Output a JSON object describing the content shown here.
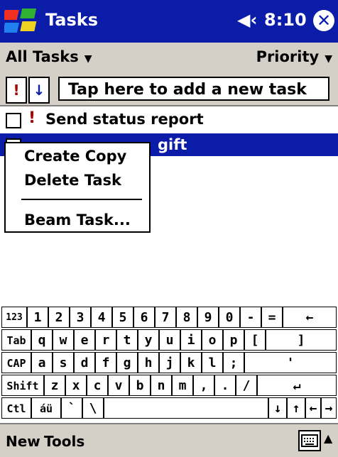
{
  "titlebar": {
    "app_title": "Tasks",
    "clock": "8:10",
    "speaker_icon": "speaker-icon",
    "close_icon": "close-icon",
    "start_icon": "windows-flag-icon"
  },
  "filter": {
    "left_label": "All Tasks",
    "right_label": "Priority"
  },
  "entry_bar": {
    "priority_button": "!",
    "sort_button": "↓",
    "placeholder": "Tap here to add a new task"
  },
  "tasks": [
    {
      "title": "Send status report",
      "priority": "!",
      "selected": false
    },
    {
      "title": "gift",
      "priority": "",
      "selected": true
    }
  ],
  "context_menu": {
    "items": [
      "Create Copy",
      "Delete Task",
      "Beam Task..."
    ]
  },
  "keyboard": {
    "rows": [
      [
        "123",
        "1",
        "2",
        "3",
        "4",
        "5",
        "6",
        "7",
        "8",
        "9",
        "0",
        "-",
        "=",
        "←"
      ],
      [
        "Tab",
        "q",
        "w",
        "e",
        "r",
        "t",
        "y",
        "u",
        "i",
        "o",
        "p",
        "[",
        "]"
      ],
      [
        "CAP",
        "a",
        "s",
        "d",
        "f",
        "g",
        "h",
        "j",
        "k",
        "l",
        ";",
        "'"
      ],
      [
        "Shift",
        "z",
        "x",
        "c",
        "v",
        "b",
        "n",
        "m",
        ",",
        ".",
        "/",
        "↵"
      ],
      [
        "Ctl",
        "áü",
        "`",
        "\\",
        "↓",
        "↑",
        "←",
        "→"
      ]
    ]
  },
  "bottom_bar": {
    "new_label": "New",
    "tools_label": "Tools",
    "sip_icon": "keyboard-icon",
    "sip_arrow": "▲"
  },
  "colors": {
    "accent": "#0a1ca8",
    "priority": "#aa0000",
    "chrome": "#d4d0c8"
  }
}
